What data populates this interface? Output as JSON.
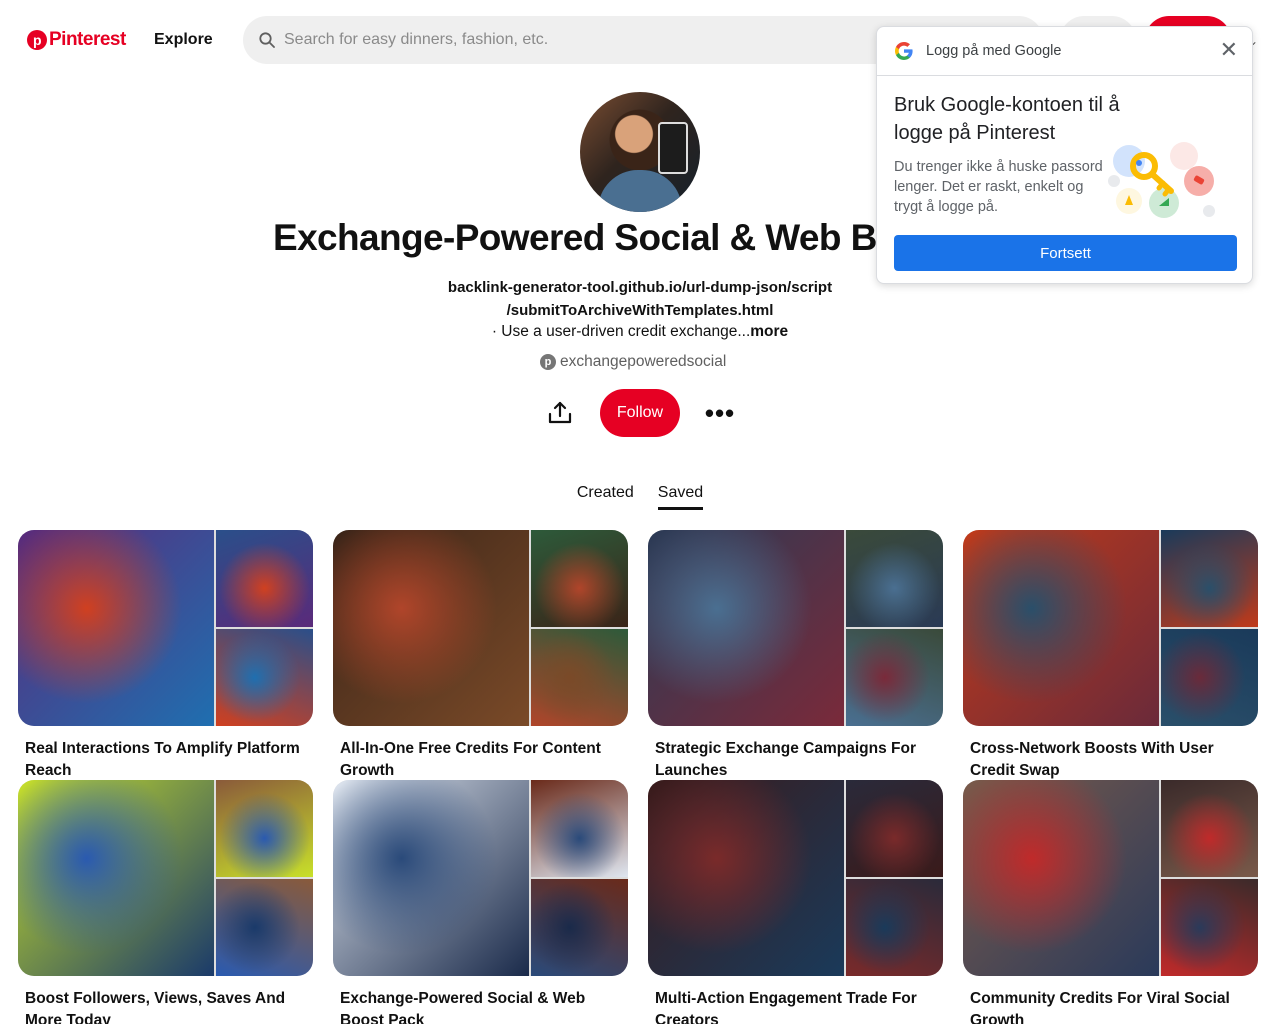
{
  "header": {
    "logo_text": "Pinterest",
    "explore_label": "Explore",
    "search_placeholder": "Search for easy dinners, fashion, etc."
  },
  "profile": {
    "name": "Exchange-Powered Social & Web Boost",
    "bio_link_line1": "backlink-generator-tool.github.io/url-dump-json/script",
    "bio_link_line2": "/submitToArchiveWithTemplates.html",
    "bio_text": "· Use a user-driven credit exchange...",
    "more_label": "more",
    "handle": "exchangepoweredsocial",
    "follow_label": "Follow"
  },
  "tabs": [
    {
      "label": "Created",
      "active": false
    },
    {
      "label": "Saved",
      "active": true
    }
  ],
  "boards": [
    {
      "title": "Real Interactions To Amplify Platform Reach",
      "colors": [
        "#5a2a7a",
        "#d04020",
        "#2a4f8a",
        "#1f6fb0"
      ]
    },
    {
      "title": "All-In-One Free Credits For Content Growth",
      "colors": [
        "#3a2418",
        "#b0452a",
        "#2d5a3a",
        "#7a4a28"
      ]
    },
    {
      "title": "Strategic Exchange Campaigns For Launches",
      "colors": [
        "#2a3a55",
        "#4a6f91",
        "#3a4a3a",
        "#7a2a3a"
      ]
    },
    {
      "title": "Cross-Network Boosts With User Credit Swap",
      "colors": [
        "#c03a1a",
        "#2a4f6a",
        "#1a3a5a",
        "#6a2a3a"
      ]
    },
    {
      "title": "Boost Followers, Views, Saves And More Today",
      "colors": [
        "#c8e02a",
        "#2a5ab0",
        "#8a5a3a",
        "#1a3a6a"
      ]
    },
    {
      "title": "Exchange-Powered Social & Web Boost Pack",
      "colors": [
        "#dfe6f0",
        "#2a4a7a",
        "#6a2a1a",
        "#1a2a4a"
      ]
    },
    {
      "title": "Multi-Action Engagement Trade For Creators",
      "colors": [
        "#3a1a1a",
        "#7a2a2a",
        "#2a2a3a",
        "#1a3a5a"
      ]
    },
    {
      "title": "Community Credits For Viral Social Growth",
      "colors": [
        "#7a5a4a",
        "#c02a2a",
        "#3a2a2a",
        "#2a3a5a"
      ]
    }
  ],
  "google_prompt": {
    "header_text": "Logg på med Google",
    "title": "Bruk Google-kontoen til å logge på Pinterest",
    "description": "Du trenger ikke å huske passord lenger. Det er raskt, enkelt og trygt å logge på.",
    "continue_label": "Fortsett"
  },
  "colors": {
    "pinterest_red": "#e60023",
    "google_blue": "#1a73e8",
    "search_bg": "#efefef"
  }
}
